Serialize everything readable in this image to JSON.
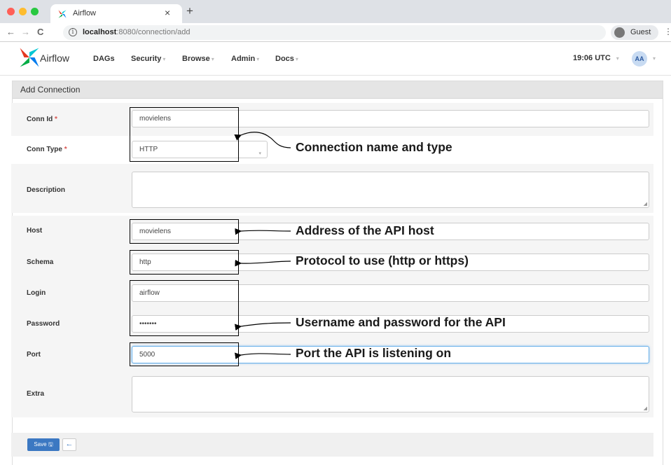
{
  "browser": {
    "tab_title": "Airflow",
    "tab_close": "×",
    "new_tab": "+",
    "back": "←",
    "forward": "→",
    "reload": "C",
    "info_glyph": "i",
    "url_host": "localhost",
    "url_rest": ":8080/connection/add",
    "profile_label": "Guest",
    "menu_glyph": "⋮",
    "traffic_colors": [
      "#ff5f57",
      "#febc2e",
      "#28c840"
    ]
  },
  "navbar": {
    "app_name": "Airflow",
    "menu": [
      {
        "label": "DAGs",
        "caret": ""
      },
      {
        "label": "Security",
        "caret": "▾"
      },
      {
        "label": "Browse",
        "caret": "▾"
      },
      {
        "label": "Admin",
        "caret": "▾"
      },
      {
        "label": "Docs",
        "caret": "▾"
      }
    ],
    "clock": "19:06 UTC",
    "clock_caret": "▾",
    "user_initials": "AA",
    "user_caret": "▾"
  },
  "panel": {
    "title": "Add Connection"
  },
  "form": {
    "required_mark": "*",
    "select_caret": "▾",
    "resize_glyph": "◢",
    "fields": {
      "conn_id": {
        "label": "Conn Id",
        "value": ""
      },
      "conn_type": {
        "label": "Conn Type",
        "value": "HTTP"
      },
      "description": {
        "label": "Description",
        "value": ""
      },
      "host": {
        "label": "Host",
        "value": "movielens"
      },
      "schema": {
        "label": "Schema",
        "value": "http"
      },
      "login": {
        "label": "Login",
        "value": "airflow"
      },
      "password": {
        "label": "Password",
        "value": "•••••••"
      },
      "port": {
        "label": "Port",
        "value": "5000"
      },
      "extra": {
        "label": "Extra",
        "value": ""
      }
    },
    "conn_id_inner": "movielens",
    "save_label": "Save",
    "save_icon": "🖫",
    "back_icon": "←"
  },
  "annotations": {
    "name_type": "Connection name and type",
    "host": "Address of the API host",
    "protocol": "Protocol to use (http or https)",
    "credentials": "Username and password for the API",
    "port": "Port the API is listening on"
  },
  "colors": {
    "primary": "#3b78c2",
    "required": "#d9534f",
    "focus": "#66afe9"
  }
}
